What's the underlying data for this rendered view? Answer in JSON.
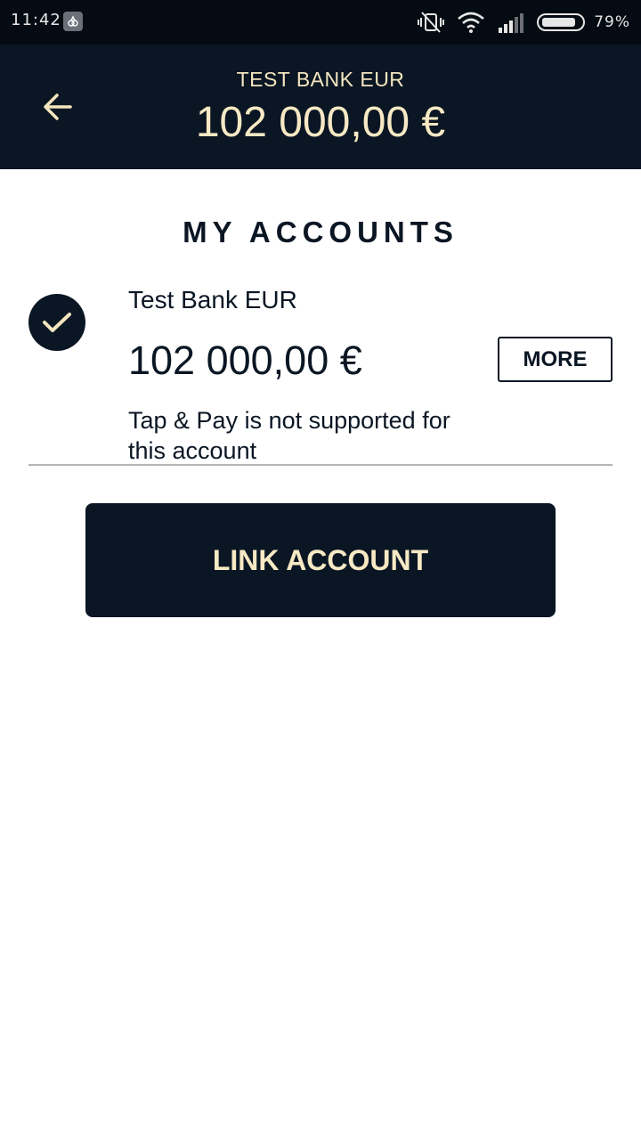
{
  "status_bar": {
    "time": "11:42",
    "battery_percent": "79%",
    "icons": [
      "app-notification-icon",
      "vibrate-off-icon",
      "wifi-icon",
      "signal-icon",
      "battery-icon"
    ]
  },
  "header": {
    "title": "TEST BANK EUR",
    "balance": "102 000,00 €",
    "back_icon": "arrow-left-icon"
  },
  "page": {
    "section_title": "MY ACCOUNTS"
  },
  "accounts": [
    {
      "name": "Test Bank EUR",
      "balance": "102 000,00 €",
      "note": "Tap & Pay is not supported for this account",
      "selected": true,
      "more_label": "MORE"
    }
  ],
  "actions": {
    "link_account_label": "LINK ACCOUNT"
  },
  "colors": {
    "navy": "#0b1624",
    "cream": "#f7e9c4",
    "status_bar": "#050b12"
  }
}
